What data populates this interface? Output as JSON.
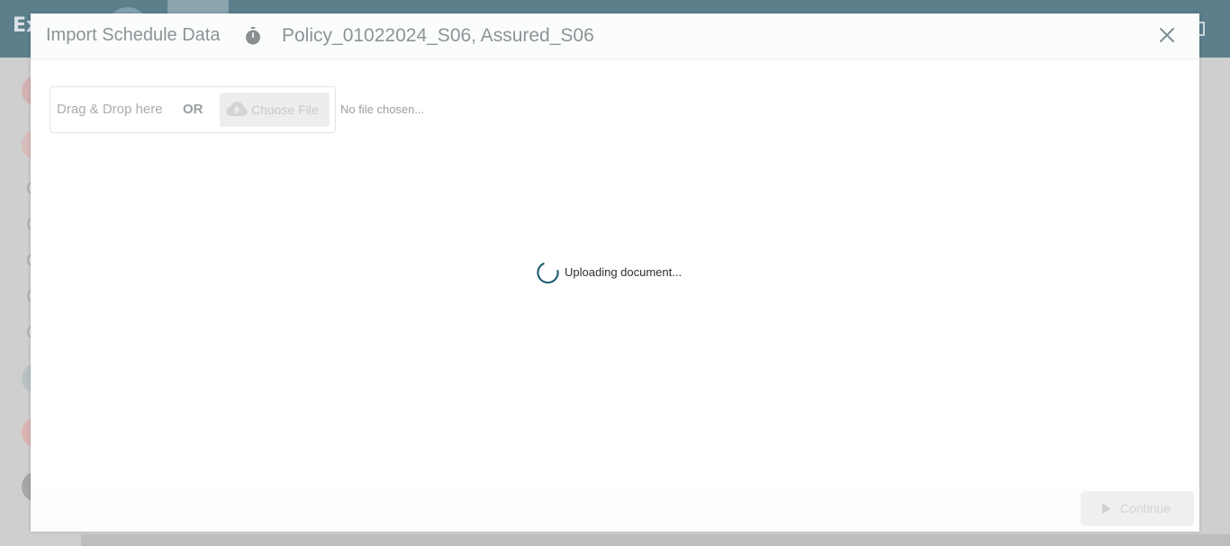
{
  "background": {
    "brand_text": "Ex"
  },
  "modal": {
    "title": "Import Schedule Data",
    "subtitle": "Policy_01022024_S06, Assured_S06",
    "upload": {
      "drag_drop_text": "Drag & Drop here",
      "or_text": "OR",
      "choose_file_label": "Choose File",
      "no_file_text": "No file chosen..."
    },
    "loading_text": "Uploading document...",
    "footer": {
      "continue_label": "Continue"
    }
  },
  "icons": {
    "timer": "stopwatch-icon",
    "close": "close-icon",
    "cloud": "cloud-upload-icon",
    "spinner": "spinner-icon",
    "play": "play-icon"
  },
  "colors": {
    "header_bg": "#5d7f8c",
    "spinner": "#1f5d73",
    "title_text": "#8e9396",
    "timer_icon": "#8a8f92"
  }
}
